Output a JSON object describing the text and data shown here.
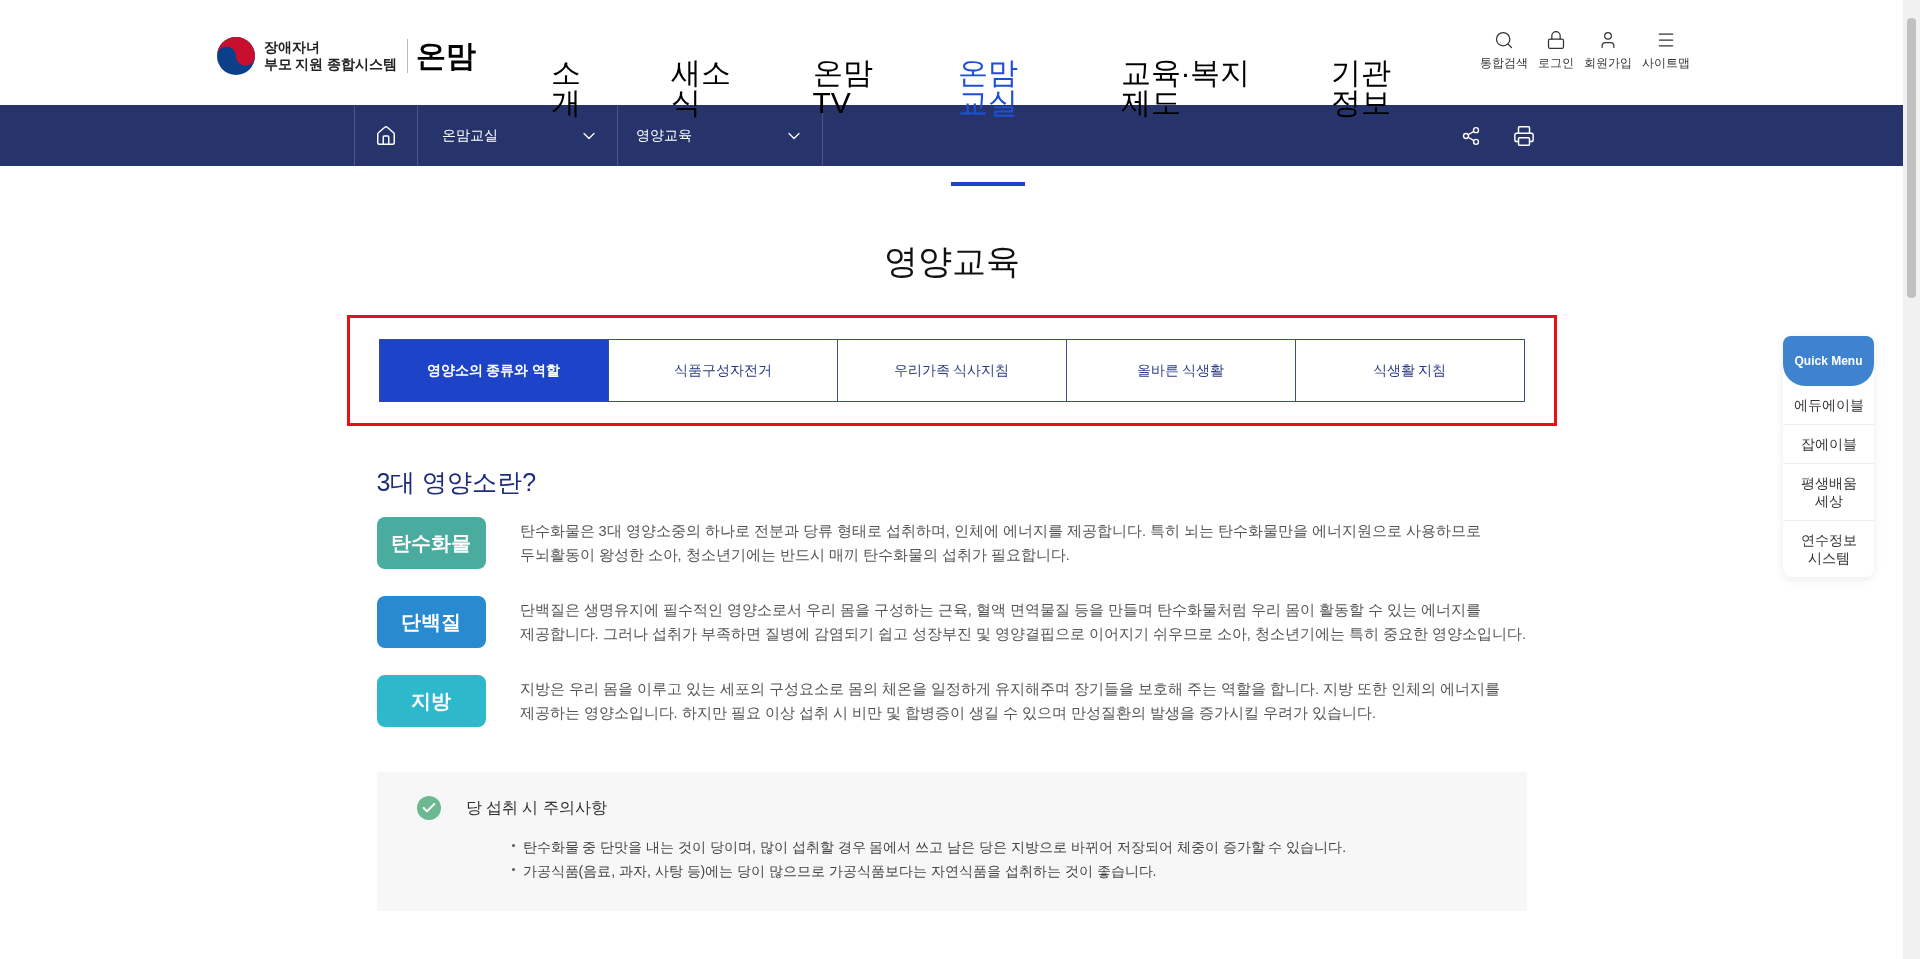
{
  "header": {
    "logo": {
      "line1": "장애자녀",
      "line2": "부모 지원 종합시스템",
      "brand": "온맘"
    },
    "nav": [
      {
        "label": "소개",
        "selected": false
      },
      {
        "label": "새소식",
        "selected": false
      },
      {
        "label": "온맘TV",
        "selected": false
      },
      {
        "label": "온맘교실",
        "selected": true
      },
      {
        "label": "교육·복지제도",
        "selected": false
      },
      {
        "label": "기관정보",
        "selected": false
      }
    ],
    "utilities": [
      {
        "label": "통합검색"
      },
      {
        "label": "로그인"
      },
      {
        "label": "회원가입"
      },
      {
        "label": "사이트맵"
      }
    ]
  },
  "breadcrumb": {
    "items": [
      "온맘교실",
      "영양교육"
    ]
  },
  "page_title": "영양교육",
  "tabs": [
    {
      "label": "영양소의 종류와 역할",
      "selected": true
    },
    {
      "label": "식품구성자전거",
      "selected": false
    },
    {
      "label": "우리가족 식사지침",
      "selected": false
    },
    {
      "label": "올바른 식생활",
      "selected": false
    },
    {
      "label": "식생활 지침",
      "selected": false
    }
  ],
  "section": {
    "heading": "3대 영양소란?",
    "nutrients": [
      {
        "name": "탄수화물",
        "color": "#4aac9e",
        "lines": [
          "탄수화물은 3대 영양소중의 하나로 전분과 당류 형태로 섭취하며, 인체에 에너지를 제공합니다. 특히 뇌는 탄수화물만을 에너지원으로 사용하므로",
          "두뇌활동이 왕성한 소아, 청소년기에는 반드시 매끼 탄수화물의 섭취가 필요합니다."
        ]
      },
      {
        "name": "단백질",
        "color": "#2a8ad0",
        "lines": [
          "단백질은 생명유지에 필수적인 영양소로서 우리 몸을 구성하는 근육, 혈액 면역물질 등을 만들며 탄수화물처럼 우리 몸이 활동할 수 있는 에너지를",
          "제공합니다. 그러나 섭취가 부족하면 질병에 감염되기 쉽고 성장부진 및 영양결핍으로 이어지기 쉬우므로 소아, 청소년기에는 특히 중요한 영양소입니다."
        ]
      },
      {
        "name": "지방",
        "color": "#2db8cc",
        "lines": [
          "지방은 우리 몸을 이루고 있는 세포의 구성요소로 몸의 체온을 일정하게 유지해주며 장기들을 보호해 주는 역할을 합니다. 지방 또한 인체의 에너지를",
          "제공하는 영양소입니다. 하지만 필요 이상 섭취 시 비만 및 합병증이 생길 수 있으며 만성질환의 발생을 증가시킬 우려가 있습니다."
        ]
      }
    ]
  },
  "notice": {
    "title": "당 섭취 시 주의사항",
    "items": [
      "탄수화물 중 단맛을 내는 것이 당이며, 많이 섭취할 경우 몸에서 쓰고 남은 당은 지방으로 바뀌어 저장되어 체중이 증가할 수 있습니다.",
      "가공식품(음료, 과자, 사탕 등)에는 당이 많으므로 가공식품보다는 자연식품을 섭취하는 것이 좋습니다."
    ]
  },
  "quick_menu": {
    "title": "Quick Menu",
    "items": [
      "에듀에이블",
      "잡에이블",
      "평생배움 세상",
      "연수정보 시스템"
    ]
  }
}
